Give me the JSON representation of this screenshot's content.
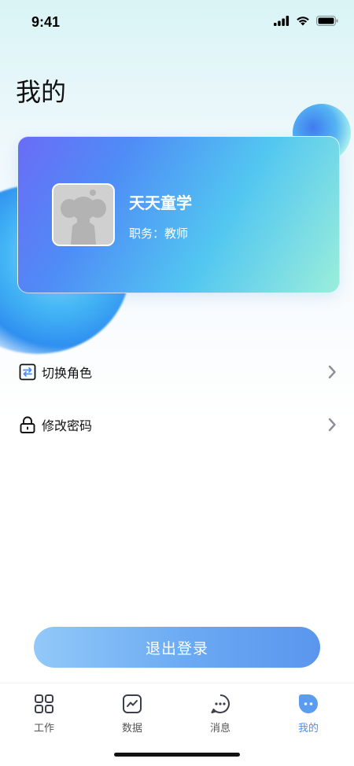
{
  "status_bar": {
    "time": "9:41",
    "icons": [
      "cellular-signal-icon",
      "wifi-icon",
      "battery-icon"
    ]
  },
  "page": {
    "title": "我的"
  },
  "profile": {
    "name": "天天童学",
    "role_label": "职务：",
    "role_value": "教师",
    "avatar_icon": "placeholder-avatar-icon"
  },
  "menu": [
    {
      "label": "切换角色",
      "icon": "switch-role-icon"
    },
    {
      "label": "修改密码",
      "icon": "lock-icon"
    }
  ],
  "logout": {
    "label": "退出登录"
  },
  "tabbar": {
    "active_color": "#4a8ff0",
    "items": [
      {
        "label": "工作",
        "icon": "grid-icon",
        "active": false
      },
      {
        "label": "数据",
        "icon": "chart-icon",
        "active": false
      },
      {
        "label": "消息",
        "icon": "chat-icon",
        "active": false
      },
      {
        "label": "我的",
        "icon": "profile-face-icon",
        "active": true
      }
    ]
  },
  "colors": {
    "card_gradient_start": "#6a6cf7",
    "card_gradient_end": "#9beedb",
    "logout_gradient_start": "#92c9f8",
    "logout_gradient_end": "#5a96ee"
  }
}
